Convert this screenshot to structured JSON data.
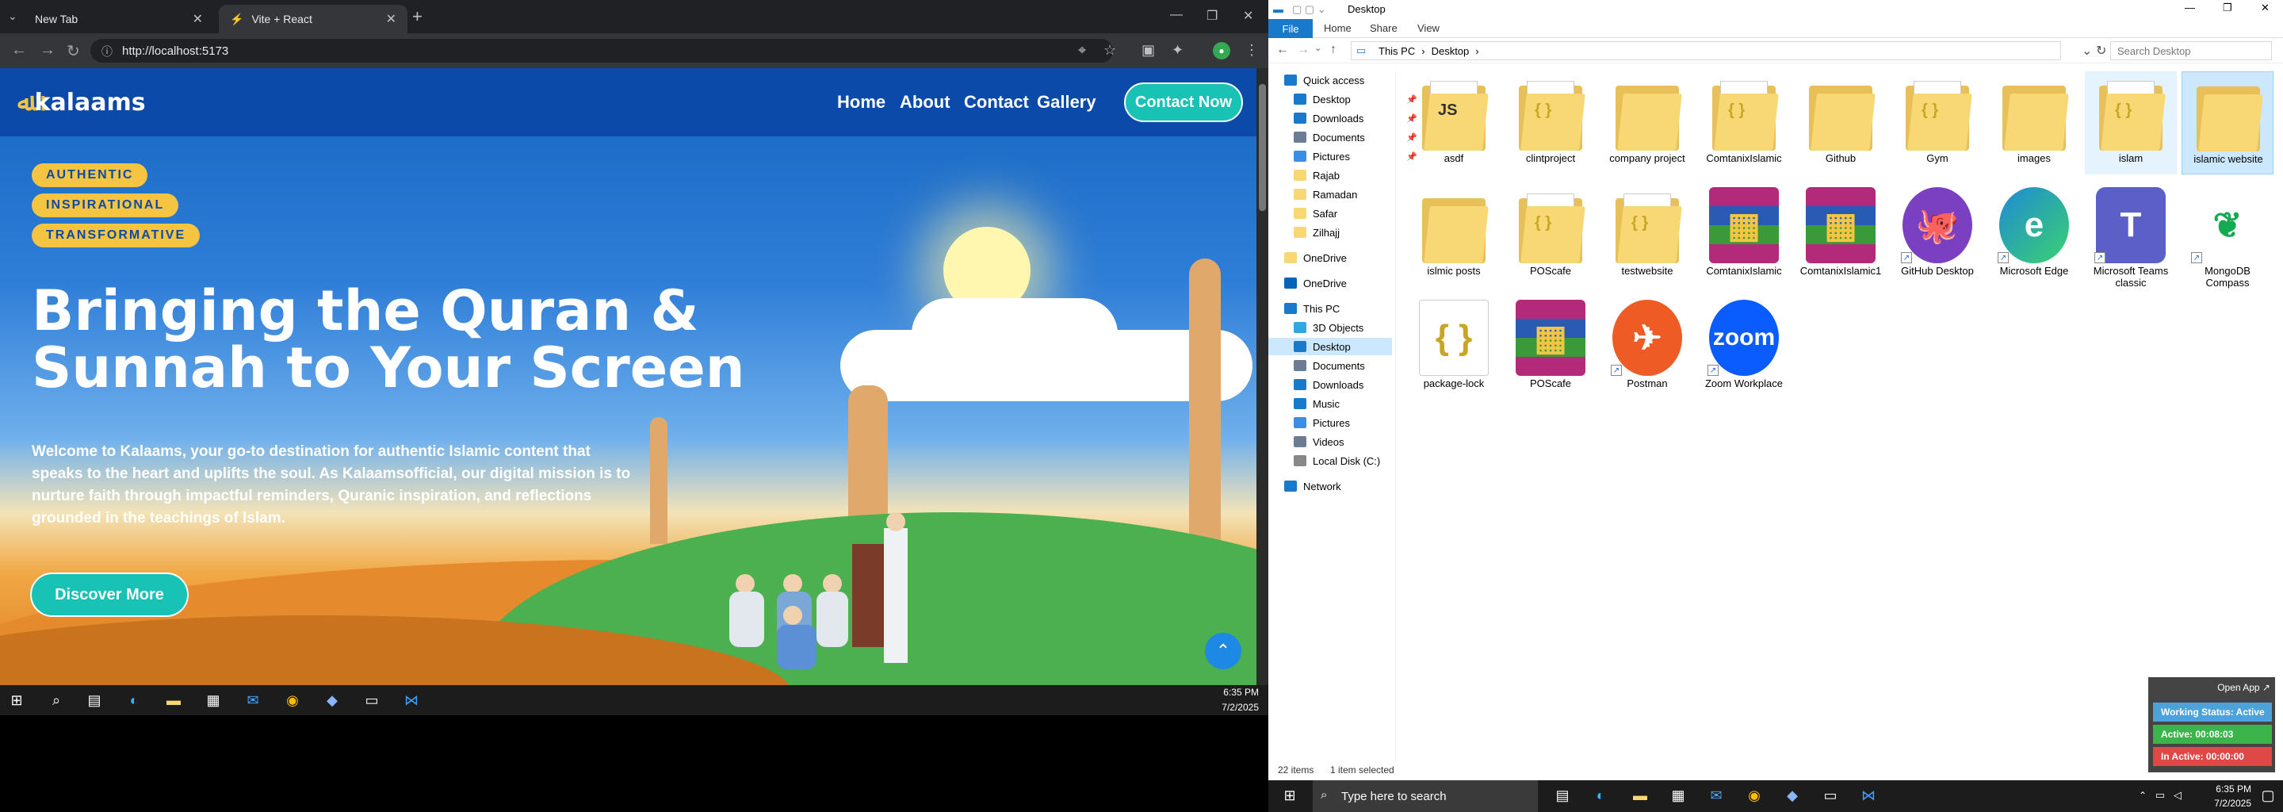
{
  "browser": {
    "tabs": [
      {
        "title": "New Tab"
      },
      {
        "title": "Vite + React"
      }
    ],
    "url": "http://localhost:5173"
  },
  "site": {
    "logo": "kalaams",
    "nav": [
      "Home",
      "About",
      "Contact",
      "Gallery"
    ],
    "cta": "Contact Now",
    "badges": [
      "AUTHENTIC",
      "INSPIRATIONAL",
      "TRANSFORMATIVE"
    ],
    "headline_1": "Bringing the Quran &",
    "headline_2": "Sunnah to Your Screen",
    "lead": "Welcome to Kalaams, your go-to destination for authentic Islamic content that speaks to the heart and uplifts the soul. As Kalaamsofficial, our digital mission is to nurture faith through impactful reminders, Quranic inspiration, and reflections grounded in the teachings of Islam.",
    "button": "Discover More"
  },
  "left_taskbar": {
    "time": "6:35 PM",
    "date": "7/2/2025"
  },
  "explorer": {
    "title": "Desktop",
    "ribbon": [
      "File",
      "Home",
      "Share",
      "View"
    ],
    "path": [
      "This PC",
      "Desktop"
    ],
    "search_placeholder": "Search Desktop",
    "nav": [
      {
        "label": "Quick access",
        "icon": "star-icon"
      },
      {
        "label": "Desktop",
        "icon": "desktop-icon",
        "pin": true
      },
      {
        "label": "Downloads",
        "icon": "download-icon",
        "pin": true
      },
      {
        "label": "Documents",
        "icon": "documents-icon",
        "pin": true
      },
      {
        "label": "Pictures",
        "icon": "pictures-icon",
        "pin": true
      },
      {
        "label": "Rajab",
        "icon": "folder-icon"
      },
      {
        "label": "Ramadan",
        "icon": "folder-icon"
      },
      {
        "label": "Safar",
        "icon": "folder-icon"
      },
      {
        "label": "Zilhajj",
        "icon": "folder-icon"
      },
      {
        "label": "OneDrive",
        "icon": "folder-icon"
      },
      {
        "label": "OneDrive",
        "icon": "cloud-icon"
      },
      {
        "label": "This PC",
        "icon": "computer-icon"
      },
      {
        "label": "3D Objects",
        "icon": "cube-icon"
      },
      {
        "label": "Desktop",
        "icon": "desktop-icon",
        "selected": true
      },
      {
        "label": "Documents",
        "icon": "documents-icon"
      },
      {
        "label": "Downloads",
        "icon": "download-icon"
      },
      {
        "label": "Music",
        "icon": "music-icon"
      },
      {
        "label": "Pictures",
        "icon": "pictures-icon"
      },
      {
        "label": "Videos",
        "icon": "video-icon"
      },
      {
        "label": "Local Disk (C:)",
        "icon": "disk-icon"
      },
      {
        "label": "Network",
        "icon": "network-icon"
      }
    ],
    "items": [
      {
        "label": "asdf",
        "kind": "folder",
        "glyph": "JS"
      },
      {
        "label": "clintproject",
        "kind": "folder",
        "glyph": "{ }"
      },
      {
        "label": "company project",
        "kind": "folder",
        "glyph": ""
      },
      {
        "label": "ComtanixIslamic",
        "kind": "folder",
        "glyph": "{ }"
      },
      {
        "label": "Github",
        "kind": "folder",
        "glyph": ""
      },
      {
        "label": "Gym",
        "kind": "folder",
        "glyph": "{ }"
      },
      {
        "label": "images",
        "kind": "folder",
        "glyph": ""
      },
      {
        "label": "islam",
        "kind": "folder",
        "glyph": "{ }",
        "hover": true
      },
      {
        "label": "islamic website",
        "kind": "folder",
        "glyph": "",
        "selected": true
      },
      {
        "label": "islmic posts",
        "kind": "folder",
        "glyph": ""
      },
      {
        "label": "POScafe",
        "kind": "folder",
        "glyph": "{ }"
      },
      {
        "label": "testwebsite",
        "kind": "folder",
        "glyph": "{ }"
      },
      {
        "label": "ComtanixIslamic",
        "kind": "winrar",
        "glyph": ""
      },
      {
        "label": "ComtanixIslamic1",
        "kind": "winrar",
        "glyph": ""
      },
      {
        "label": "GitHub Desktop",
        "kind": "github",
        "glyph": ""
      },
      {
        "label": "Microsoft Edge",
        "kind": "edge",
        "glyph": ""
      },
      {
        "label": "Microsoft Teams classic",
        "kind": "teams",
        "glyph": "T"
      },
      {
        "label": "MongoDB Compass",
        "kind": "mongo",
        "glyph": ""
      },
      {
        "label": "package-lock",
        "kind": "json",
        "glyph": "{ }"
      },
      {
        "label": "POScafe",
        "kind": "winrar",
        "glyph": ""
      },
      {
        "label": "Postman",
        "kind": "postman",
        "glyph": ""
      },
      {
        "label": "Zoom Workplace",
        "kind": "zoom",
        "glyph": "zoom"
      }
    ],
    "status_count": "22 items",
    "status_selected": "1 item selected"
  },
  "widget": {
    "open": "Open App ↗",
    "status": "Working Status: Active",
    "active": "Active: 00:08:03",
    "inactive": "In Active: 00:00:00"
  },
  "right_taskbar": {
    "search": "Type here to search",
    "time": "6:35 PM",
    "date": "7/2/2025"
  }
}
